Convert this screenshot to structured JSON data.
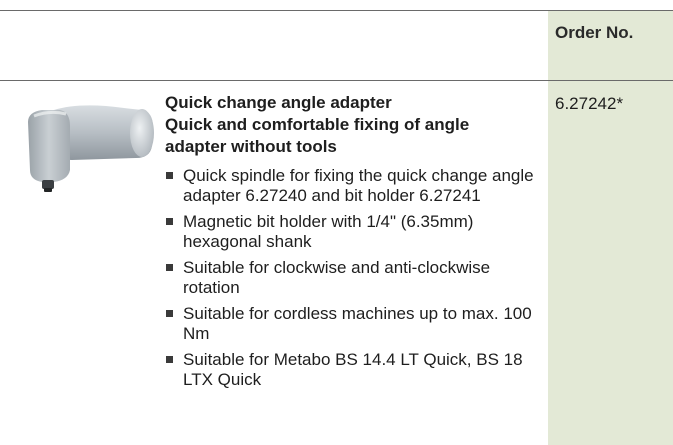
{
  "table": {
    "order_header": "Order No."
  },
  "product": {
    "image_icon": "angle-adapter-image",
    "title_lines": [
      "Quick change angle adapter",
      "Quick and comfortable fixing of angle",
      "adapter without tools"
    ],
    "features": [
      "Quick spindle for fixing the quick change angle adapter 6.27240 and bit holder 6.27241",
      "Magnetic bit holder with 1/4\" (6.35mm) hexagonal shank",
      "Suitable for clockwise and anti-clockwise rotation",
      "Suitable for cordless machines up to max. 100 Nm",
      "Suitable for Metabo BS 14.4 LT Quick, BS 18 LTX Quick"
    ],
    "order_no": "6.27242*"
  },
  "colors": {
    "order_column_bg": "#e3e9d6",
    "rule": "#6a6a6a",
    "text": "#1e1e1e"
  }
}
